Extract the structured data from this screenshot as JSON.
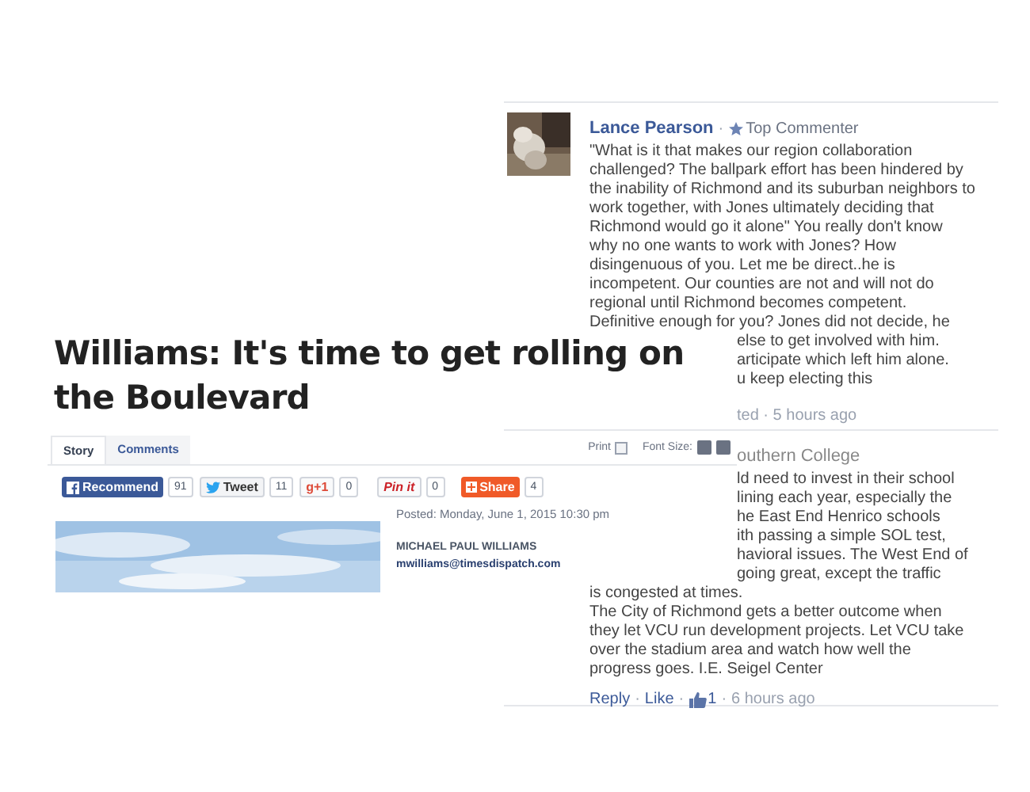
{
  "comments": [
    {
      "author": "Lance Pearson",
      "separator": "·",
      "badge": "Top Commenter",
      "avatar": {
        "kind": "picture"
      },
      "body": [
        {
          "kind": "full",
          "lines": [
            "\"What is it that makes our region collaboration",
            "challenged? The ballpark effort has been hindered by",
            "the inability of Richmond and its suburban neighbors to",
            "work together, with Jones ultimately deciding that",
            "Richmond would go it alone\" You really don't know",
            "why no one wants to work with Jones? How",
            "disingenuous of you. Let me be direct..he is",
            "incompetent. Our counties are not and will not do",
            "regional until Richmond becomes competent.",
            "Definitive enough for you? Jones did not decide, he"
          ]
        },
        {
          "kind": "partial",
          "lines": [
            "else to get involved with him.",
            "articipate which left him alone.",
            "u keep electing this"
          ]
        }
      ],
      "meta": "ted · 5 hours ago"
    },
    {
      "author": "outhern College",
      "body": [
        {
          "kind": "partial",
          "lines": [
            "ld need to invest in their school",
            "lining each year, especially the",
            "he East End Henrico schools",
            "ith passing a simple SOL test,",
            "havioral issues. The West End of",
            "going great, except the traffic"
          ]
        },
        {
          "kind": "full",
          "lines": [
            "is congested at times.",
            "The City of Richmond gets a better outcome when",
            "they let VCU run development projects. Let VCU take",
            "over the stadium area and watch how well the",
            "progress goes. I.E. Seigel Center"
          ]
        }
      ],
      "actions": [
        {
          "kind": "link",
          "text": "Reply"
        },
        {
          "kind": "separator",
          "text": "·"
        },
        {
          "kind": "link",
          "text": "Like"
        },
        {
          "kind": "separator",
          "text": "·"
        },
        {
          "kind": "likes",
          "text": "1"
        },
        {
          "kind": "separator",
          "text": "·"
        },
        {
          "kind": "time",
          "text": "6 hours ago"
        }
      ]
    }
  ],
  "headline": "Williams: It's time to get rolling on the Boulevard",
  "article": {
    "tabs": [
      {
        "label": "Story",
        "selected": true
      },
      {
        "label": "Comments",
        "selected": false
      }
    ],
    "print": "Print",
    "font_size": "Font Size:",
    "share": [
      {
        "kind": "facebook",
        "label": "Recommend",
        "count": "91"
      },
      {
        "kind": "twitter",
        "label": "Tweet",
        "count": "11"
      },
      {
        "kind": "gplus",
        "label": "g+1",
        "count": "0"
      },
      {
        "kind": "pinterest",
        "label": "Pin it",
        "count": "0"
      },
      {
        "kind": "share",
        "label": "Share",
        "count": "4"
      }
    ],
    "photo": {
      "kind": "picture"
    },
    "posted": "Posted: Monday, June 1, 2015 10:30 pm",
    "byline": "MICHAEL PAUL WILLIAMS",
    "email": "mwilliams@timesdispatch.com"
  }
}
